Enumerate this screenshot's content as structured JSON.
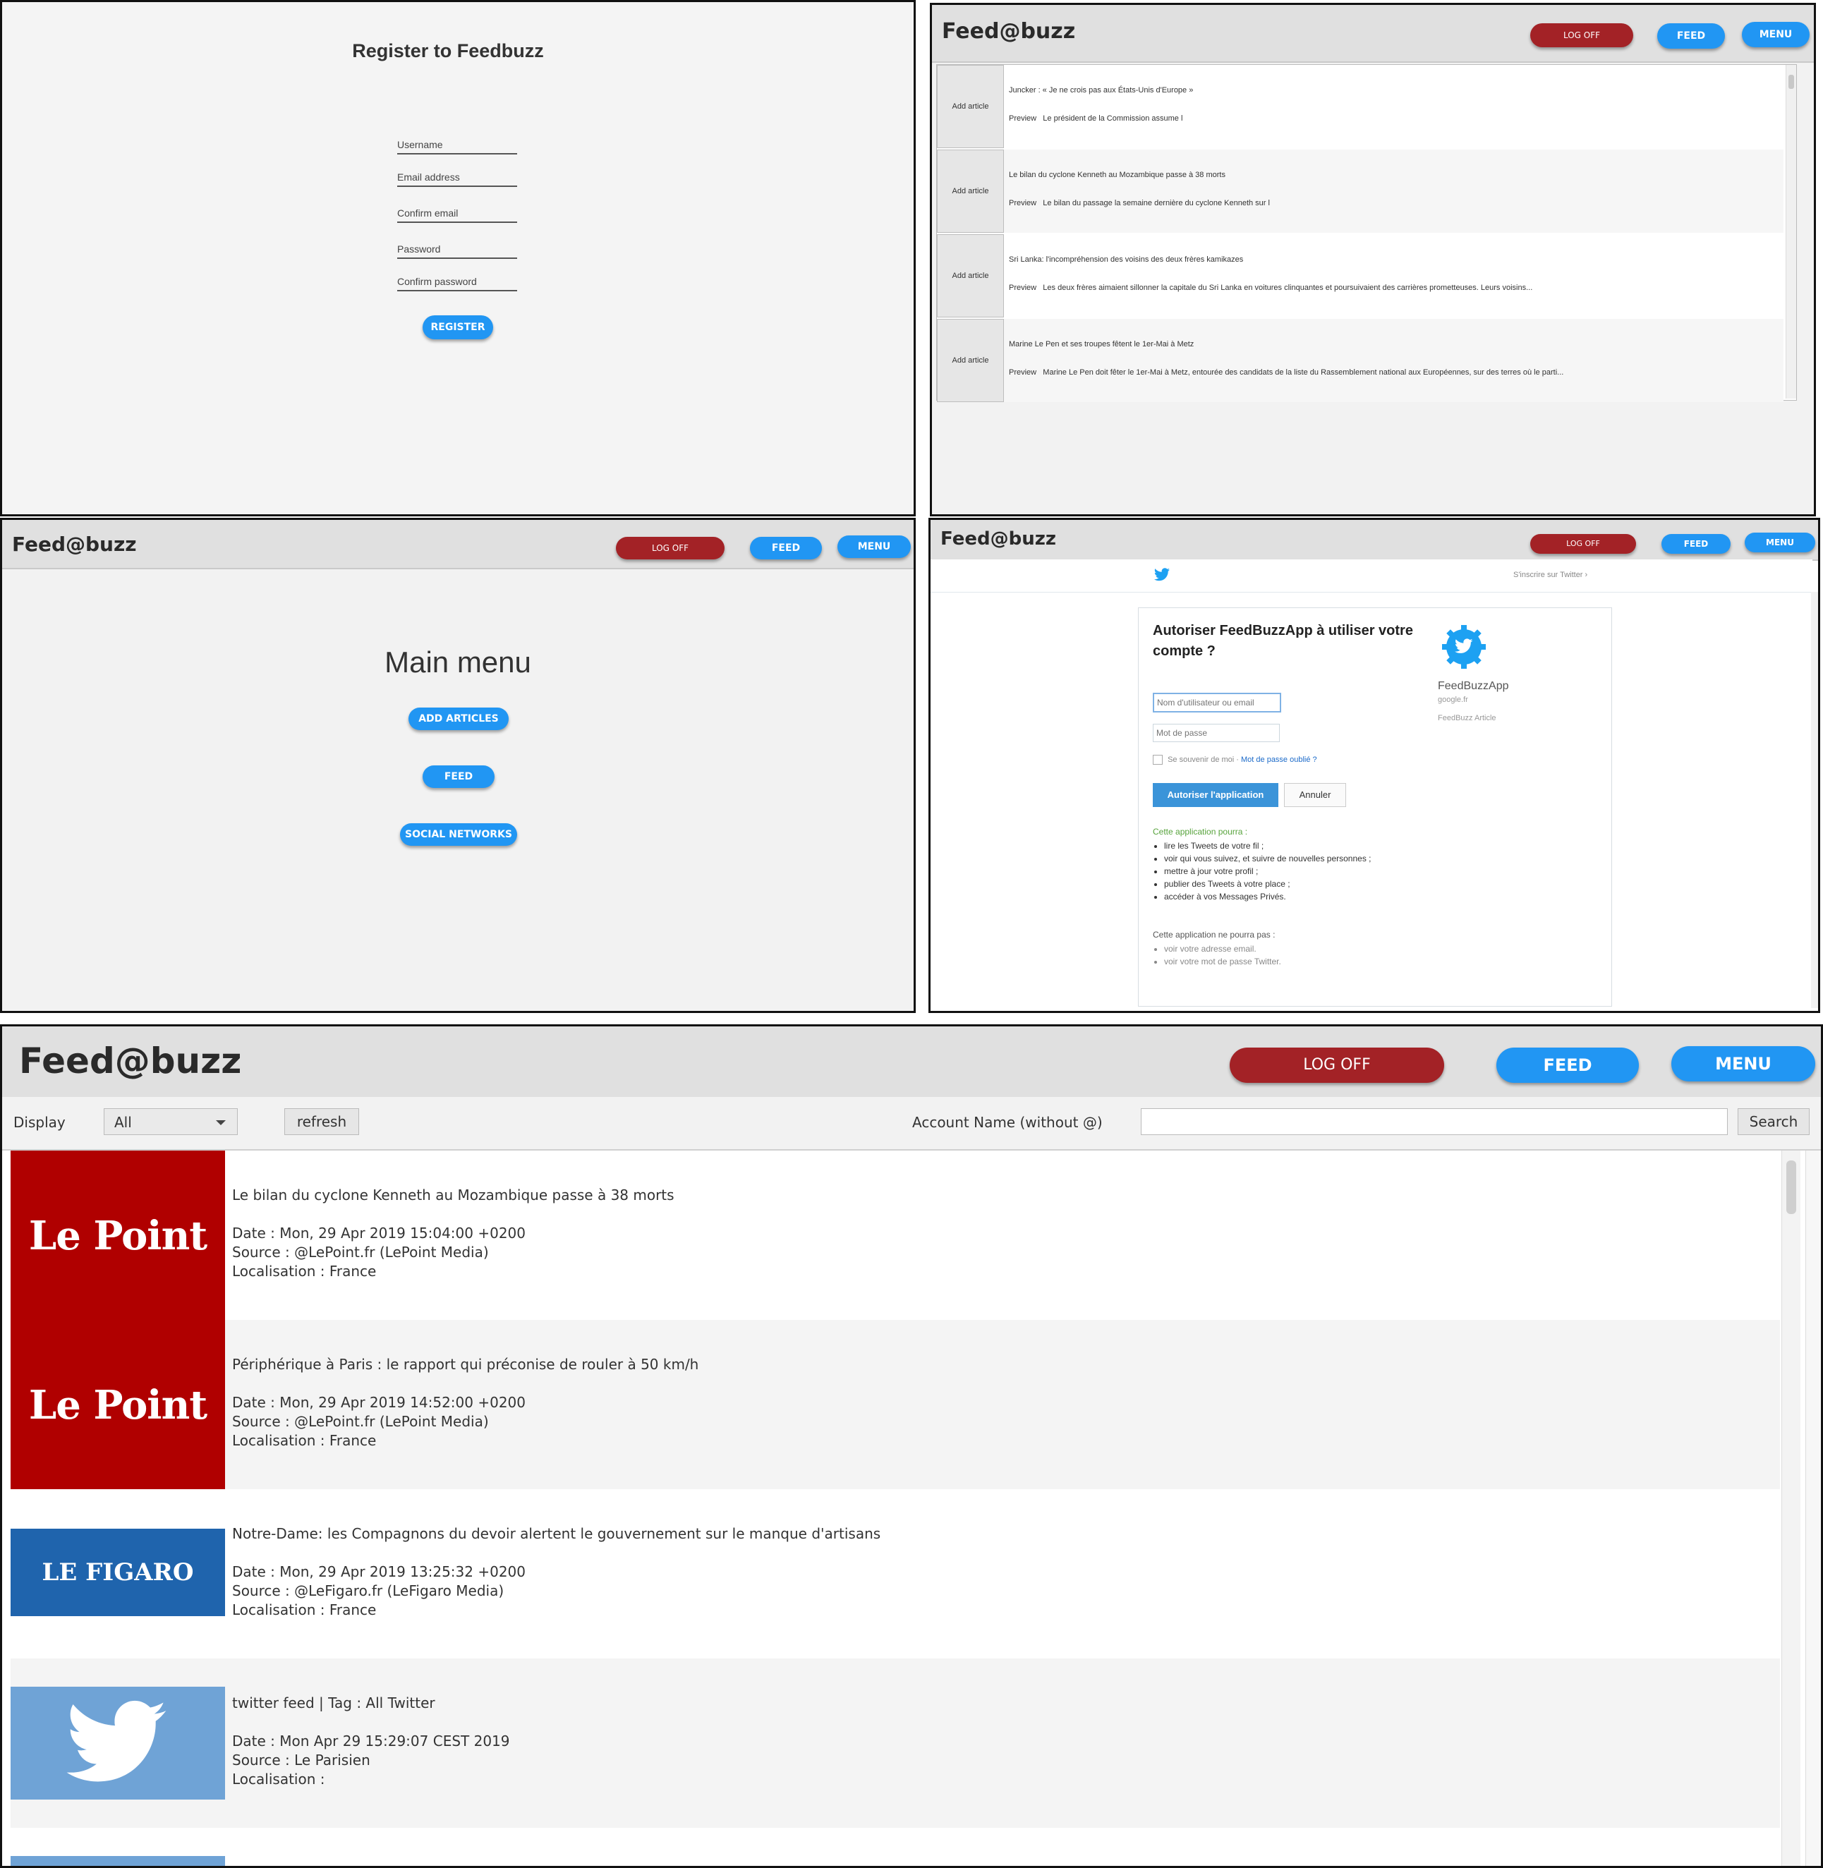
{
  "register": {
    "title": "Register to Feedbuzz",
    "fields": [
      "Username",
      "Email address",
      "Confirm email",
      "Password",
      "Confirm password"
    ],
    "button": "REGISTER"
  },
  "nav": {
    "logo": "Feed@buzz",
    "logoff": "LOG OFF",
    "feed": "FEED",
    "menu": "MENU"
  },
  "add_articles": {
    "items": [
      {
        "button": "Add article",
        "title": "Juncker : « Je ne crois pas aux États-Unis d'Europe »",
        "preview_label": "Preview",
        "preview": "Le président de la Commission assume l"
      },
      {
        "button": "Add article",
        "title": "Le bilan du cyclone Kenneth au Mozambique passe à 38 morts",
        "preview_label": "Preview",
        "preview": "Le bilan du passage la semaine dernière du cyclone Kenneth sur l"
      },
      {
        "button": "Add article",
        "title": "Sri Lanka: l'incompréhension des voisins des deux frères kamikazes",
        "preview_label": "Preview",
        "preview": "Les deux frères aimaient sillonner la capitale du Sri Lanka en voitures clinquantes et poursuivaient des carrières prometteuses. Leurs voisins..."
      },
      {
        "button": "Add article",
        "title": "Marine Le Pen et ses troupes fêtent le 1er-Mai à Metz",
        "preview_label": "Preview",
        "preview": "Marine Le Pen doit fêter le 1er-Mai à Metz, entourée des candidats de la liste du Rassemblement national aux Européennes, sur des terres où le parti..."
      }
    ]
  },
  "main_menu": {
    "title": "Main menu",
    "buttons": [
      "ADD ARTICLES",
      "FEED",
      "SOCIAL NETWORKS"
    ]
  },
  "twitter_auth": {
    "signup": "S'inscrire sur Twitter ›",
    "heading": "Autoriser FeedBuzzApp à utiliser votre compte ?",
    "username_placeholder": "Nom d'utilisateur ou email",
    "password_placeholder": "Mot de passe",
    "remember": "Se souvenir de moi ·",
    "forgot": "Mot de passe oublié ?",
    "authorize": "Autoriser l'application",
    "cancel": "Annuler",
    "app_name": "FeedBuzzApp",
    "app_site": "google.fr",
    "app_desc": "FeedBuzz Article",
    "can_title": "Cette application pourra :",
    "can": [
      "lire les Tweets de votre fil ;",
      "voir qui vous suivez, et suivre de nouvelles personnes ;",
      "mettre à jour votre profil ;",
      "publier des Tweets à votre place ;",
      "accéder à vos Messages Privés."
    ],
    "cannot_title": "Cette application ne pourra pas :",
    "cannot": [
      "voir votre adresse email.",
      "voir votre mot de passe Twitter."
    ]
  },
  "feed": {
    "display_label": "Display",
    "display_value": "All",
    "refresh": "refresh",
    "account_label": "Account Name (without @)",
    "account_value": "",
    "search": "Search",
    "items": [
      {
        "logo": "Le Point",
        "title": "Le bilan du cyclone Kenneth au Mozambique passe à 38 morts",
        "date": "Date : Mon, 29 Apr 2019 15:04:00 +0200",
        "source": "Source : @LePoint.fr (LePoint Media)",
        "location": "Localisation : France"
      },
      {
        "logo": "Le Point",
        "title": "Périphérique à Paris : le rapport qui préconise de rouler à 50 km/h",
        "date": "Date : Mon, 29 Apr 2019 14:52:00 +0200",
        "source": "Source : @LePoint.fr (LePoint Media)",
        "location": "Localisation : France"
      },
      {
        "logo": "LE FIGARO",
        "title": "Notre-Dame: les Compagnons du devoir alertent le gouvernement sur le manque d'artisans",
        "date": "Date : Mon, 29 Apr 2019 13:25:32 +0200",
        "source": "Source : @LeFigaro.fr (LeFigaro Media)",
        "location": "Localisation : France"
      },
      {
        "logo": "twitter",
        "title": "twitter feed | Tag : All Twitter",
        "date": "Date : Mon Apr 29 15:29:07 CEST 2019",
        "source": "Source : Le Parisien",
        "location": "Localisation :"
      }
    ]
  },
  "colors": {
    "red": "#a32226",
    "blue": "#2196f3",
    "lepoint": "#b00000",
    "figaro": "#1f64ad",
    "twitter": "#6fa3d6"
  }
}
